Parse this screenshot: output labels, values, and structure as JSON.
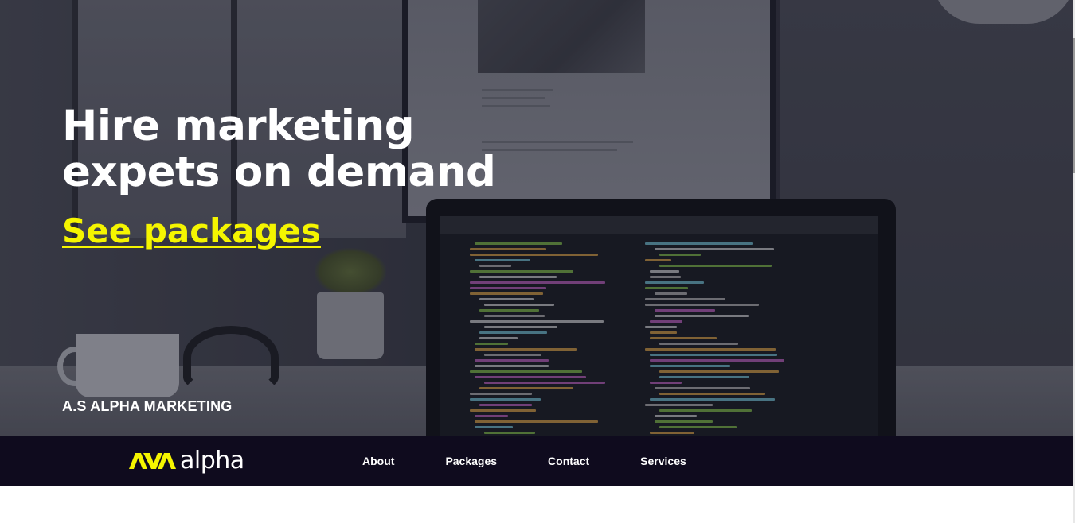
{
  "hero": {
    "title_line1": "Hire marketing",
    "title_line2": "expets on demand",
    "cta_label": "See packages",
    "brand_label": "A.S ALPHA MARKETING"
  },
  "navbar": {
    "logo_text": "alpha",
    "links": [
      {
        "label": "About"
      },
      {
        "label": "Packages"
      },
      {
        "label": "Contact"
      },
      {
        "label": "Services"
      }
    ]
  },
  "colors": {
    "accent_yellow": "#f5f500",
    "navbar_bg": "#0f0b1e",
    "text_white": "#ffffff"
  },
  "icons": {
    "logo_mark": "alpha-logo-icon"
  }
}
